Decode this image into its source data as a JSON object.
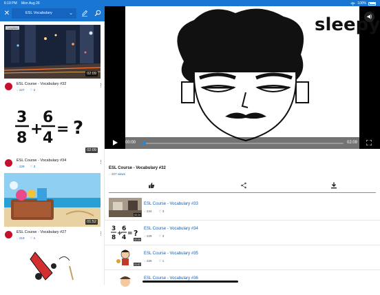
{
  "status_bar": {
    "time": "6:19 PM",
    "date": "Mon Aug 26",
    "battery": "100%"
  },
  "app_bar": {
    "playlist_label": "ESL Vocabulary"
  },
  "sidebar": {
    "items": [
      {
        "title": "ESL Course - Vocabulary #32",
        "duration": "02:09",
        "views": "227",
        "likes": "2",
        "thumb_label": "Completed"
      },
      {
        "title": "ESL Course - Vocabulary #34",
        "duration": "02:09",
        "views": "229",
        "likes": "3",
        "fraction": "3/8+6/4=?"
      },
      {
        "title": "ESL Course - Vocabulary #27",
        "duration": "01:52",
        "views": "219",
        "likes": "1"
      }
    ]
  },
  "player": {
    "caption_word": "sleepy",
    "current_time": "00:00",
    "total_time": "02:09",
    "progress": 0.01
  },
  "video_info": {
    "title": "ESL Course - Vocabulary #32",
    "views": "227 views"
  },
  "related": [
    {
      "title": "ESL Course - Vocabulary #33",
      "views": "244",
      "likes": "3",
      "duration": "02:24"
    },
    {
      "title": "ESL Course - Vocabulary #34",
      "views": "229",
      "likes": "3",
      "duration": "02:09"
    },
    {
      "title": "ESL Course - Vocabulary #35",
      "views": "226",
      "likes": "1",
      "duration": "01:57"
    },
    {
      "title": "ESL Course - Vocabulary #36",
      "views": "",
      "likes": "",
      "duration": ""
    }
  ],
  "colors": {
    "brand": "#1976d2",
    "accent": "#1e88e5",
    "channel": "#c8102e"
  }
}
